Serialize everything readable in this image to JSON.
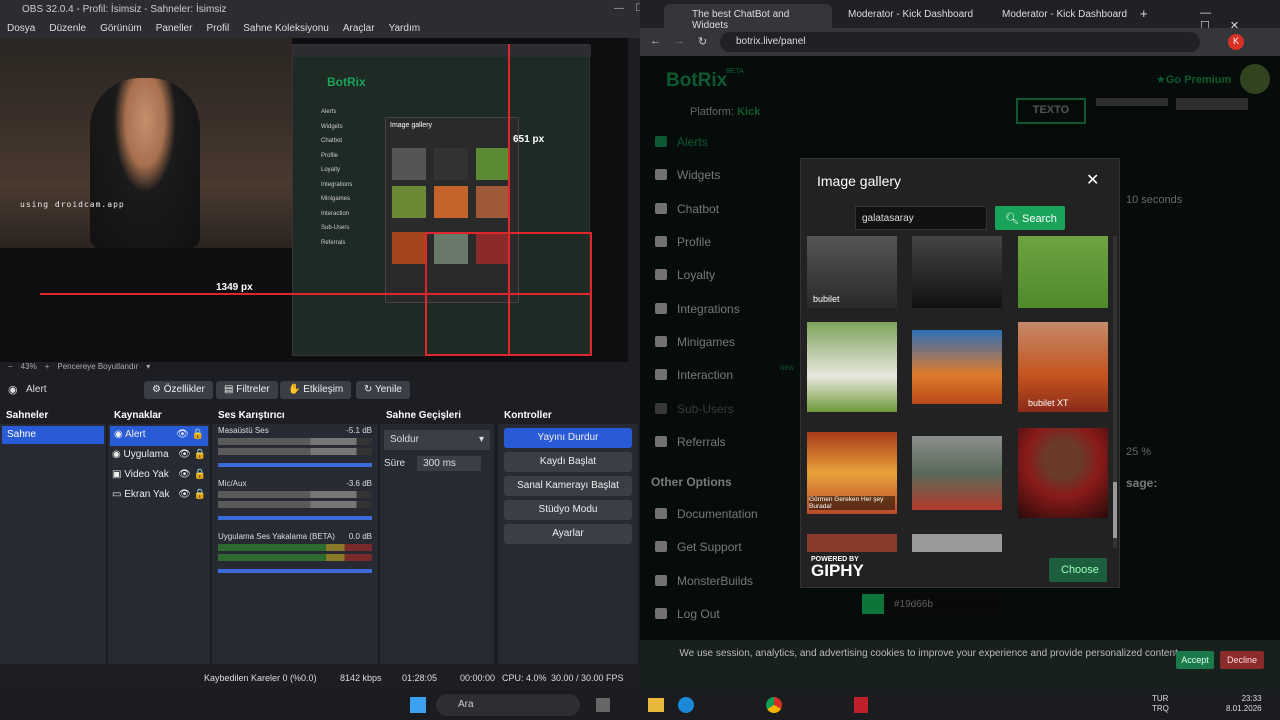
{
  "obs": {
    "title": "OBS 32.0.4 - Profil: İsimsiz - Sahneler: İsimsiz",
    "menu": [
      "Dosya",
      "Düzenle",
      "Görünüm",
      "Paneller",
      "Profil",
      "Sahne Koleksiyonu",
      "Araçlar",
      "Yardım"
    ],
    "webcam_text": "using droidcam.app",
    "px_width": "1349 px",
    "px_height": "651 px",
    "zoom": "43%",
    "resize_label": "Pencereye Boyutlandır",
    "source_label": "Alert",
    "buttons": {
      "props": "Özellikler",
      "filters": "Filtreler",
      "interact": "Etkileşim",
      "refresh": "Yenile"
    },
    "docks": {
      "scenes": "Sahneler",
      "sources": "Kaynaklar",
      "mixer": "Ses Karıştırıcı",
      "transitions": "Sahne Geçişleri",
      "controls": "Kontroller"
    },
    "scene": "Sahne",
    "sources": [
      "Alert",
      "Uygulama",
      "Video Yak",
      "Ekran Yak"
    ],
    "mixer": [
      {
        "name": "Masaüstü Ses",
        "db": "-5.1 dB"
      },
      {
        "name": "Mic/Aux",
        "db": "-3.6 dB"
      },
      {
        "name": "Uygulama Ses Yakalama (BETA)",
        "db": "0.0 dB"
      }
    ],
    "transition": {
      "type": "Soldur",
      "duration_label": "Süre",
      "duration": "300 ms"
    },
    "controls": [
      "Yayını Durdur",
      "Kaydı Başlat",
      "Sanal Kamerayı Başlat",
      "Stüdyo Modu",
      "Ayarlar"
    ],
    "status": {
      "dropped": "Kaybedilen Kareler 0 (%0.0)",
      "bitrate": "8142 kbps",
      "live": "01:28:05",
      "rec": "00:00:00",
      "cpu": "CPU: 4.0%",
      "fps": "30.00 / 30.00 FPS"
    }
  },
  "chrome": {
    "tabs": [
      "The best ChatBot and Widgets",
      "Moderator - Kick Dashboard",
      "Moderator - Kick Dashboard"
    ],
    "url": "botrix.live/panel"
  },
  "botrix": {
    "brand": "BotRix",
    "beta": "BETA",
    "platform_label": "Platform:",
    "platform": "Kick",
    "premium": "Go Premium",
    "sidebar": [
      "Alerts",
      "Widgets",
      "Chatbot",
      "Profile",
      "Loyalty",
      "Integrations",
      "Minigames",
      "Interaction",
      "Sub-Users",
      "Referrals"
    ],
    "new_badge": "NEW",
    "other_options": "Other Options",
    "other": [
      "Documentation",
      "Get Support",
      "MonsterBuilds",
      "Log Out"
    ],
    "texto": "TEXTO",
    "seconds": "10 seconds",
    "percent": "25 %",
    "message": "sage:",
    "color_value": "#19d66b",
    "cookie_text": "We use session, analytics, and advertising cookies to improve your experience and provide personalized content.",
    "accept": "Accept",
    "decline": "Decline"
  },
  "gallery": {
    "title": "Image gallery",
    "query": "galatasaray",
    "search": "Search",
    "powered": "POWERED BY",
    "giphy": "GIPHY",
    "choose": "Choose",
    "captions": [
      "bubilet",
      "",
      "",
      "",
      "",
      "bubilet XT",
      "Görmen Gereken Her şey Burada!",
      "",
      ""
    ]
  },
  "taskbar": {
    "search": "Ara",
    "lang": "TUR",
    "lang2": "TRQ",
    "time": "23:33",
    "date": "8.01.2026"
  }
}
